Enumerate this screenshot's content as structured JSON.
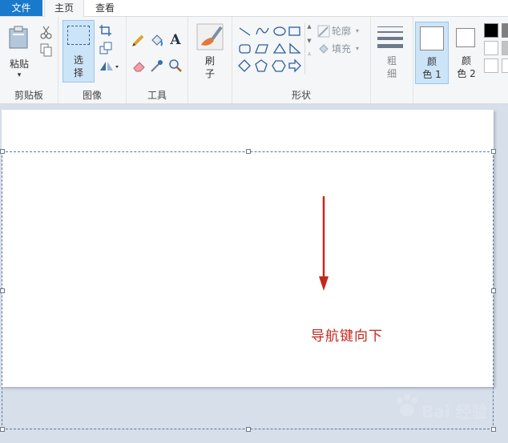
{
  "tabs": {
    "file": "文件",
    "home": "主页",
    "view": "查看"
  },
  "clipboard": {
    "paste_top": "粘贴",
    "group": "剪贴板"
  },
  "image": {
    "select_top": "选",
    "select_bottom": "择",
    "group": "图像"
  },
  "tools": {
    "group": "工具"
  },
  "brush": {
    "top": "刷",
    "bottom": "子"
  },
  "shapes": {
    "outline": "轮廓",
    "fill": "填充",
    "group": "形状"
  },
  "size": {
    "top": "粗",
    "bottom": "细"
  },
  "color1": {
    "top": "颜",
    "bottom": "色 1"
  },
  "color2": {
    "top": "颜",
    "bottom": "色 2"
  },
  "canvas": {
    "text": "导航键向下",
    "accent_color": "#c4281c",
    "watermark": "Bai 经验"
  },
  "colors": {
    "selected_tab": "#1979ca",
    "active_button": "#cce4f7"
  }
}
